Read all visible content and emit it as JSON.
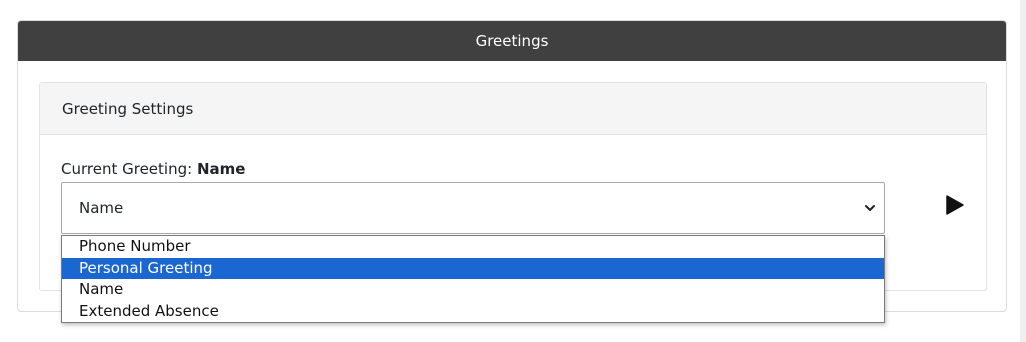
{
  "panel": {
    "title": "Greetings"
  },
  "settings": {
    "header": "Greeting Settings",
    "current_label": "Current Greeting:",
    "current_value": "Name"
  },
  "select": {
    "value": "Name",
    "options": [
      {
        "label": "Phone Number",
        "selected": false
      },
      {
        "label": "Personal Greeting",
        "selected": true
      },
      {
        "label": "Name",
        "selected": false
      },
      {
        "label": "Extended Absence",
        "selected": false
      }
    ]
  },
  "icons": {
    "chevron": "chevron-down-icon",
    "play": "play-icon"
  },
  "colors": {
    "header_bg": "#404040",
    "highlight": "#1a67d2"
  }
}
